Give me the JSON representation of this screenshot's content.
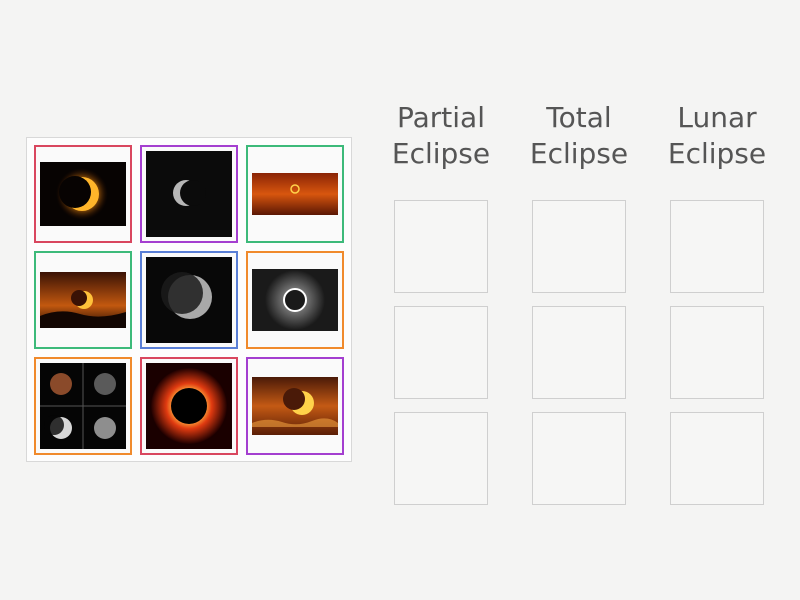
{
  "columns": [
    {
      "title_line1": "Partial",
      "title_line2": "Eclipse"
    },
    {
      "title_line1": "Total",
      "title_line2": "Eclipse"
    },
    {
      "title_line1": "Lunar",
      "title_line2": "Eclipse"
    }
  ],
  "cards": [
    {
      "image": "partial-solar-eclipse-crescent",
      "border_color": "#d9475f"
    },
    {
      "image": "crescent-moon",
      "border_color": "#a43fd0"
    },
    {
      "image": "annular-eclipse-red-sky",
      "border_color": "#3dba7a"
    },
    {
      "image": "partial-eclipse-sunset",
      "border_color": "#3dba7a"
    },
    {
      "image": "partial-lunar-eclipse",
      "border_color": "#5a7fd6"
    },
    {
      "image": "diamond-ring-corona",
      "border_color": "#f08a2c"
    },
    {
      "image": "lunar-eclipse-phases",
      "border_color": "#f08a2c"
    },
    {
      "image": "total-solar-eclipse-corona",
      "border_color": "#d9475f"
    },
    {
      "image": "partial-eclipse-clouds",
      "border_color": "#a43fd0"
    }
  ],
  "theme": {
    "heading_color": "#555555",
    "background": "#f4f4f3"
  }
}
